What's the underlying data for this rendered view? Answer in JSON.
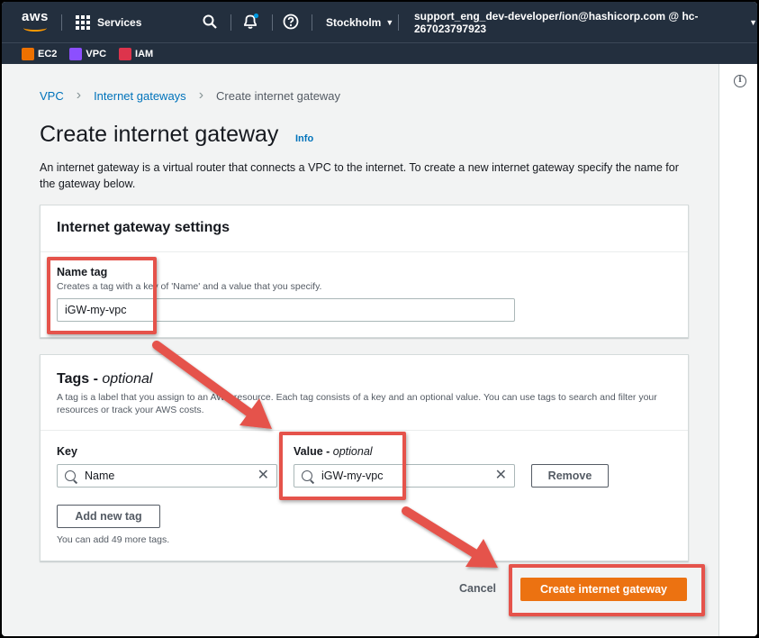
{
  "topnav": {
    "logo": "aws",
    "services": "Services",
    "region": "Stockholm",
    "account": "support_eng_dev-developer/ion@hashicorp.com @ hc-267023797923"
  },
  "favorites": [
    {
      "label": "EC2",
      "color": "#ed7100"
    },
    {
      "label": "VPC",
      "color": "#8c4fff"
    },
    {
      "label": "IAM",
      "color": "#dd344c"
    }
  ],
  "breadcrumb": {
    "vpc": "VPC",
    "igws": "Internet gateways",
    "current": "Create internet gateway"
  },
  "page": {
    "title": "Create internet gateway",
    "info": "Info",
    "description": "An internet gateway is a virtual router that connects a VPC to the internet. To create a new internet gateway specify the name for the gateway below."
  },
  "settings": {
    "header": "Internet gateway settings",
    "name_tag_label": "Name tag",
    "name_tag_hint": "Creates a tag with a key of 'Name' and a value that you specify.",
    "name_tag_value": "iGW-my-vpc"
  },
  "tags": {
    "header": "Tags - ",
    "header_optional": "optional",
    "description": "A tag is a label that you assign to an AWS resource. Each tag consists of a key and an optional value. You can use tags to search and filter your resources or track your AWS costs.",
    "key_label": "Key",
    "value_label": "Value - ",
    "value_optional": "optional",
    "key_value": "Name",
    "value_value": "iGW-my-vpc",
    "remove": "Remove",
    "add_new": "Add new tag",
    "remaining": "You can add 49 more tags."
  },
  "actions": {
    "cancel": "Cancel",
    "create": "Create internet gateway"
  },
  "colors": {
    "nav_bg": "#232f3e",
    "primary": "#ec7211",
    "link": "#0073bb",
    "annotation": "#e5534b"
  }
}
